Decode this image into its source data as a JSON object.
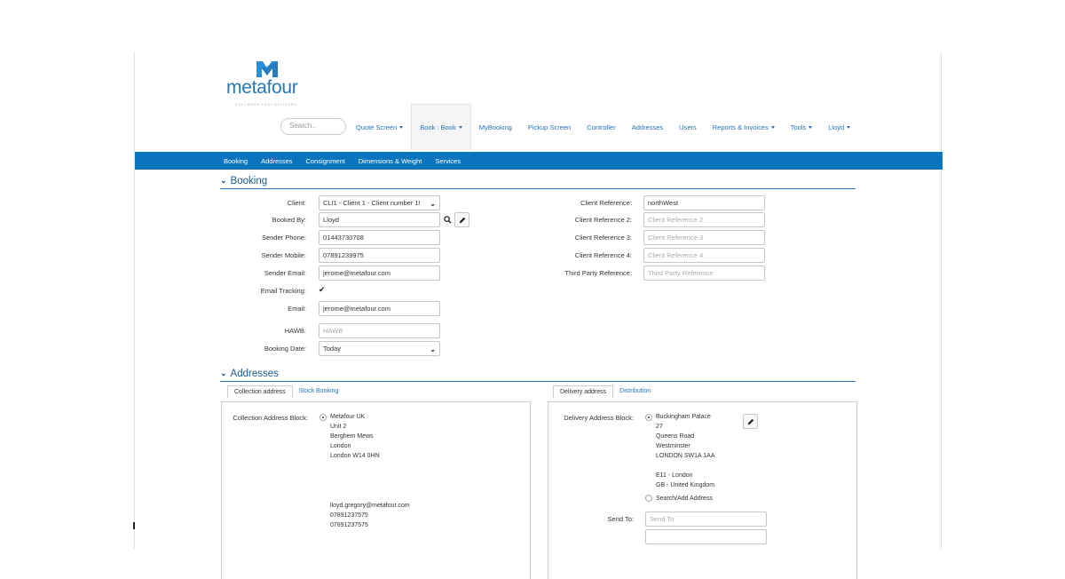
{
  "logo": {
    "text": "metafour",
    "tagline": "SOFTWARE THAT DELIVERS"
  },
  "search": {
    "placeholder": "Search.."
  },
  "topnav": [
    {
      "label": "Quote Screen",
      "caret": true
    },
    {
      "label": "Book : Book",
      "caret": true,
      "active": true
    },
    {
      "label": "MyBooking"
    },
    {
      "label": "Pickup Screen"
    },
    {
      "label": "Controller"
    },
    {
      "label": "Addresses"
    },
    {
      "label": "Users"
    },
    {
      "label": "Reports & Invoices",
      "caret": true
    },
    {
      "label": "Tools",
      "caret": true
    },
    {
      "label": "Lloyd",
      "caret": true
    }
  ],
  "subnav": [
    "Booking",
    "Addresses",
    "Consignment",
    "Dimensions & Weight",
    "Services"
  ],
  "booking": {
    "title": "Booking",
    "client_label": "Client:",
    "client_value": "CLI1 - Client 1 - Client number 1!",
    "booked_by_label": "Booked By:",
    "booked_by_value": "Lloyd",
    "sender_phone_label": "Sender Phone:",
    "sender_phone_value": "01443730708",
    "sender_mobile_label": "Sender Mobile:",
    "sender_mobile_value": "07891239975",
    "sender_email_label": "Sender Email:",
    "sender_email_value": "jerome@metafour.com",
    "email_tracking_label": "Email Tracking:",
    "email_tracking_checked": true,
    "email_label": "Email:",
    "email_value": "jerome@metafour.com",
    "hawb_label": "HAWB:",
    "hawb_placeholder": "HAWB",
    "booking_date_label": "Booking Date:",
    "booking_date_value": "Today",
    "client_ref_label": "Client Reference:",
    "client_ref_value": "northWest",
    "client_ref2_label": "Client Reference 2:",
    "client_ref2_placeholder": "Client Reference 2",
    "client_ref3_label": "Client Reference 3:",
    "client_ref3_placeholder": "Client Reference 3",
    "client_ref4_label": "Client Reference 4:",
    "client_ref4_placeholder": "Client Reference 4",
    "third_party_label": "Third Party Reference:",
    "third_party_placeholder": "Third Party Reference"
  },
  "addresses": {
    "title": "Addresses",
    "left_tabs": [
      "Collection address",
      "Stock Booking"
    ],
    "right_tabs": [
      "Delivery address",
      "Distribution"
    ],
    "collection_label": "Collection Address Block:",
    "collection_lines": [
      "Metafour UK",
      "Unit 2",
      "Berghem Mews",
      "London",
      "London  W14 0HN"
    ],
    "collection_contact": [
      "lloyd.gregory@metafour.com",
      "07891237575",
      "07891237575"
    ],
    "delivery_label": "Delivery Address Block:",
    "delivery_lines": [
      "Buckingham Palace",
      "27",
      "Queens Road",
      "Westminster",
      "LONDON  SW1A 1AA"
    ],
    "delivery_extra": [
      "E11 - London",
      "GB - United Kingdom"
    ],
    "search_add_label": "Search/Add Address",
    "send_to_label": "Send To:",
    "send_to_placeholder": "Send To"
  },
  "colors": {
    "brand_blue": "#0a75bd",
    "link_blue": "#2a6ebb",
    "section_blue": "#1c5a8f"
  }
}
